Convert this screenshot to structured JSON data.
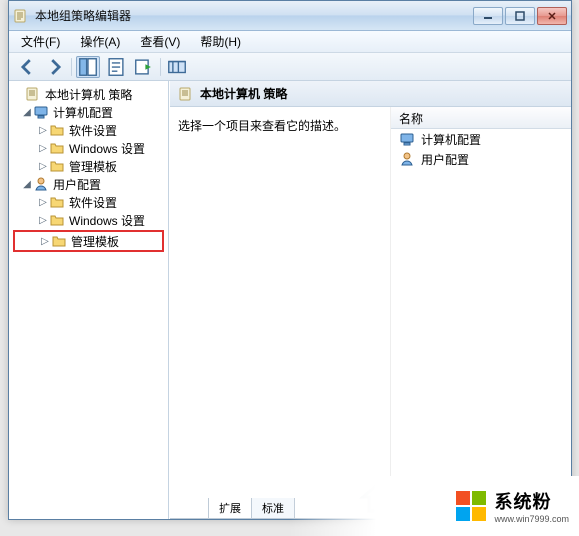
{
  "window": {
    "title": "本地组策略编辑器"
  },
  "menus": {
    "file": "文件(F)",
    "action": "操作(A)",
    "view": "查看(V)",
    "help": "帮助(H)"
  },
  "tree": {
    "root": "本地计算机 策略",
    "computer_config": "计算机配置",
    "software_settings_1": "软件设置",
    "windows_settings_1": "Windows 设置",
    "admin_templates_1": "管理模板",
    "user_config": "用户配置",
    "software_settings_2": "软件设置",
    "windows_settings_2": "Windows 设置",
    "admin_templates_2": "管理模板"
  },
  "right": {
    "heading": "本地计算机 策略",
    "description": "选择一个项目来查看它的描述。",
    "col_name": "名称",
    "item_computer": "计算机配置",
    "item_user": "用户配置"
  },
  "tabs": {
    "extended": "扩展",
    "standard": "标准"
  },
  "branding": {
    "name": "系统粉",
    "url": "www.win7999.com"
  }
}
